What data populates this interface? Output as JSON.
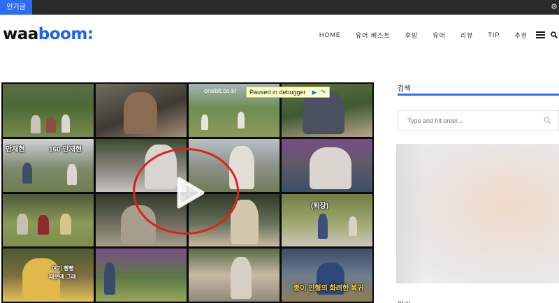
{
  "topbar": {
    "badge_label": "인기글",
    "edge_icon": "gear-icon"
  },
  "header": {
    "logo_part1": "waa",
    "logo_part2": "boom:",
    "nav": [
      "HOME",
      "유머 베스트",
      "후방",
      "유머",
      "리뷰",
      "TIP",
      "추천"
    ],
    "menu_icon": "hamburger-icon",
    "search_icon": "search-icon"
  },
  "video": {
    "url_label": "onebit.co.kr",
    "debugger_label": "Paused in debugger",
    "captions": {
      "name1": "안재현",
      "name2": "160 안재현",
      "retreat": "(퇴장)",
      "line1": "여기 빵빵",
      "line2": "때문에 그래",
      "bottom": "종이 인형의 화려한 복귀"
    },
    "play_icon": "play-icon"
  },
  "sidebar": {
    "search_title": "검색",
    "search_placeholder": "Type and hit enter...",
    "next_title": "인기"
  },
  "colors": {
    "accent": "#2b6cf6",
    "logo_blue": "#1e63e9",
    "circle_red": "#e0201c"
  }
}
